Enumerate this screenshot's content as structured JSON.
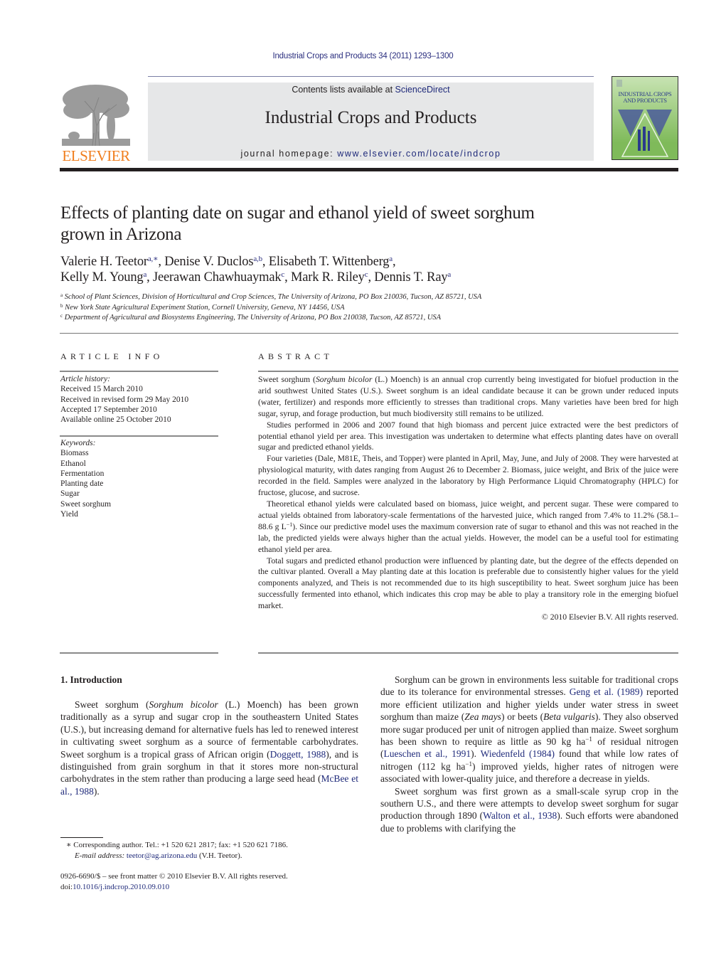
{
  "header": {
    "running_head": "Industrial Crops and Products 34 (2011) 1293–1300",
    "contents_prefix": "Contents lists available at ",
    "contents_link": "ScienceDirect",
    "journal_title": "Industrial Crops and Products",
    "homepage_prefix": "journal homepage: ",
    "homepage_link": "www.elsevier.com/locate/indcrop",
    "publisher_logo_text": "ELSEVIER",
    "cover_title": "INDUSTRIAL CROPS AND PRODUCTS",
    "colors": {
      "publisher_orange": "#f07e1e",
      "link_blue": "#1f2a7a",
      "banner_gray": "#e6e7e8",
      "cover_green": "#7fba5a"
    }
  },
  "article": {
    "title": "Effects of planting date on sugar and ethanol yield of sweet sorghum grown in Arizona",
    "authors": [
      {
        "name": "Valerie H. Teetor",
        "sup": "a,∗",
        "sep": ", "
      },
      {
        "name": "Denise V. Duclos",
        "sup": "a,b",
        "sep": ", "
      },
      {
        "name": "Elisabeth T. Wittenberg",
        "sup": "a",
        "sep": ","
      },
      {
        "name": "Kelly M. Young",
        "sup": "a",
        "sep": ", "
      },
      {
        "name": "Jeerawan Chawhuaymak",
        "sup": "c",
        "sep": ", "
      },
      {
        "name": "Mark R. Riley",
        "sup": "c",
        "sep": ", "
      },
      {
        "name": "Dennis T. Ray",
        "sup": "a",
        "sep": ""
      }
    ],
    "affiliations": [
      {
        "mark": "a",
        "text": "School of Plant Sciences, Division of Horticultural and Crop Sciences, The University of Arizona, PO Box 210036, Tucson, AZ 85721, USA"
      },
      {
        "mark": "b",
        "text": "New York State Agricultural Experiment Station, Cornell University, Geneva, NY 14456, USA"
      },
      {
        "mark": "c",
        "text": "Department of Agricultural and Biosystems Engineering, The University of Arizona, PO Box 210038, Tucson, AZ 85721, USA"
      }
    ]
  },
  "article_info": {
    "heading": "ARTICLE INFO",
    "history_label": "Article history:",
    "history": [
      "Received 15 March 2010",
      "Received in revised form 29 May 2010",
      "Accepted 17 September 2010",
      "Available online 25 October 2010"
    ],
    "keywords_label": "Keywords:",
    "keywords": [
      "Biomass",
      "Ethanol",
      "Fermentation",
      "Planting date",
      "Sugar",
      "Sweet sorghum",
      "Yield"
    ]
  },
  "abstract": {
    "heading": "ABSTRACT",
    "p1_a": "Sweet sorghum (",
    "p1_ital": "Sorghum bicolor",
    "p1_b": " (L.) Moench) is an annual crop currently being investigated for biofuel production in the arid southwest United States (U.S.). Sweet sorghum is an ideal candidate because it can be grown under reduced inputs (water, fertilizer) and responds more efficiently to stresses than traditional crops. Many varieties have been bred for high sugar, syrup, and forage production, but much biodiversity still remains to be utilized.",
    "p2": "Studies performed in 2006 and 2007 found that high biomass and percent juice extracted were the best predictors of potential ethanol yield per area. This investigation was undertaken to determine what effects planting dates have on overall sugar and predicted ethanol yields.",
    "p3": "Four varieties (Dale, M81E, Theis, and Topper) were planted in April, May, June, and July of 2008. They were harvested at physiological maturity, with dates ranging from August 26 to December 2. Biomass, juice weight, and Brix of the juice were recorded in the field. Samples were analyzed in the laboratory by High Performance Liquid Chromatography (HPLC) for fructose, glucose, and sucrose.",
    "p4_a": "Theoretical ethanol yields were calculated based on biomass, juice weight, and percent sugar. These were compared to actual yields obtained from laboratory-scale fermentations of the harvested juice, which ranged from 7.4% to 11.2% (58.1–88.6 g L",
    "p4_sup": "−1",
    "p4_b": "). Since our predictive model uses the maximum conversion rate of sugar to ethanol and this was not reached in the lab, the predicted yields were always higher than the actual yields. However, the model can be a useful tool for estimating ethanol yield per area.",
    "p5": "Total sugars and predicted ethanol production were influenced by planting date, but the degree of the effects depended on the cultivar planted. Overall a May planting date at this location is preferable due to consistently higher values for the yield components analyzed, and Theis is not recommended due to its high susceptibility to heat. Sweet sorghum juice has been successfully fermented into ethanol, which indicates this crop may be able to play a transitory role in the emerging biofuel market.",
    "copyright": "© 2010 Elsevier B.V. All rights reserved."
  },
  "introduction": {
    "heading": "1.  Introduction",
    "left_p1_a": "Sweet sorghum (",
    "left_p1_ital": "Sorghum bicolor",
    "left_p1_b": " (L.) Moench) has been grown traditionally as a syrup and sugar crop in the southeastern United States (U.S.), but increasing demand for alternative fuels has led to renewed interest in cultivating sweet sorghum as a source of fermentable carbohydrates. Sweet sorghum is a tropical grass of African origin (",
    "left_p1_ref1": "Doggett, 1988",
    "left_p1_c": "), and is distinguished from grain sorghum in that it stores more non-structural carbohydrates in the stem rather than producing a large seed head (",
    "left_p1_ref2": "McBee et al., 1988",
    "left_p1_d": ").",
    "right_p1_a": "Sorghum can be grown in environments less suitable for traditional crops due to its tolerance for environmental stresses. ",
    "right_p1_ref1": "Geng et al. (1989)",
    "right_p1_b": " reported more efficient utilization and higher yields under water stress in sweet sorghum than maize (",
    "right_p1_ital1": "Zea mays",
    "right_p1_c": ") or beets (",
    "right_p1_ital2": "Beta vulgaris",
    "right_p1_d": "). They also observed more sugar produced per unit of nitrogen applied than maize. Sweet sorghum has been shown to require as little as 90 kg ha",
    "right_p1_sup1": "−1",
    "right_p1_e": " of residual nitrogen (",
    "right_p1_ref2": "Lueschen et al., 1991",
    "right_p1_f": "). ",
    "right_p1_ref3": "Wiedenfeld (1984)",
    "right_p1_g": " found that while low rates of nitrogen (112 kg ha",
    "right_p1_sup2": "−1",
    "right_p1_h": ") improved yields, higher rates of nitrogen were associated with lower-quality juice, and therefore a decrease in yields.",
    "right_p2_a": "Sweet sorghum was first grown as a small-scale syrup crop in the southern U.S., and there were attempts to develop sweet sorghum for sugar production through 1890 (",
    "right_p2_ref": "Walton et al., 1938",
    "right_p2_b": "). Such efforts were abandoned due to problems with clarifying the"
  },
  "footnote": {
    "mark": "∗",
    "text": " Corresponding author. Tel.: +1 520 621 2817; fax: +1 520 621 7186.",
    "email_label": "E-mail address:",
    "email": "teetor@ag.arizona.edu",
    "email_suffix": " (V.H. Teetor)."
  },
  "front_matter": {
    "issn_line": "0926-6690/$ – see front matter © 2010 Elsevier B.V. All rights reserved.",
    "doi_prefix": "doi:",
    "doi": "10.1016/j.indcrop.2010.09.010"
  }
}
